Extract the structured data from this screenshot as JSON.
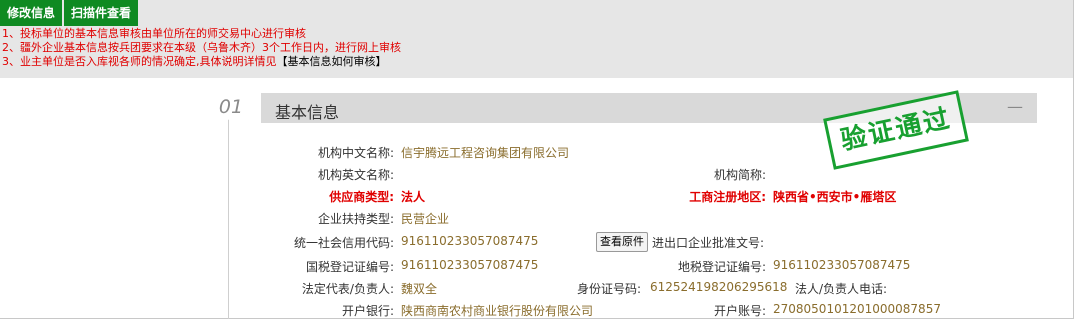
{
  "toolbar": {
    "edit_label": "修改信息",
    "scan_label": "扫描件查看"
  },
  "notes": {
    "line1": "1、投标单位的基本信息审核由单位所在的师交易中心进行审核",
    "line2": "2、疆外企业基本信息按兵团要求在本级（乌鲁木齐）3个工作日内，进行网上审核",
    "line3": "3、业主单位是否入库视各师的情况确定,具体说明详情见",
    "line3_link": "【基本信息如何审核】"
  },
  "section": {
    "number": "01",
    "title": "基本信息",
    "collapse": "—"
  },
  "stamp": "验证通过",
  "colors": {
    "toolbar_green": "#0f8a22",
    "required_red": "#e00000",
    "value_brown": "#8a6d2d",
    "stamp_green": "#18a030"
  },
  "fields": {
    "cn_name_label": "机构中文名称:",
    "cn_name_value": "信宇腾远工程咨询集团有限公司",
    "en_name_label": "机构英文名称:",
    "short_name_label": "机构简称:",
    "supplier_type_label": "供应商类型:",
    "supplier_type_value": "法人",
    "region_label": "工商注册地区:",
    "region_value": "陕西省•西安市•雁塔区",
    "support_type_label": "企业扶持类型:",
    "support_type_value": "民营企业",
    "credit_code_label": "统一社会信用代码:",
    "credit_code_value": "916110233057087475",
    "view_original_label": "查看原件",
    "import_export_label": "进出口企业批准文号:",
    "national_tax_label": "国税登记证编号:",
    "national_tax_value": "916110233057087475",
    "local_tax_label": "地税登记证编号:",
    "local_tax_value": "916110233057087475",
    "legal_rep_label": "法定代表/负责人:",
    "legal_rep_value": "魏双全",
    "id_label": "身份证号码:",
    "id_value": "612524198206295618",
    "legal_phone_label": "法人/负责人电话:",
    "bank_label": "开户银行:",
    "bank_value": "陕西商南农村商业银行股份有限公司",
    "account_label": "开户账号:",
    "account_value": "2708050101201000087857"
  }
}
